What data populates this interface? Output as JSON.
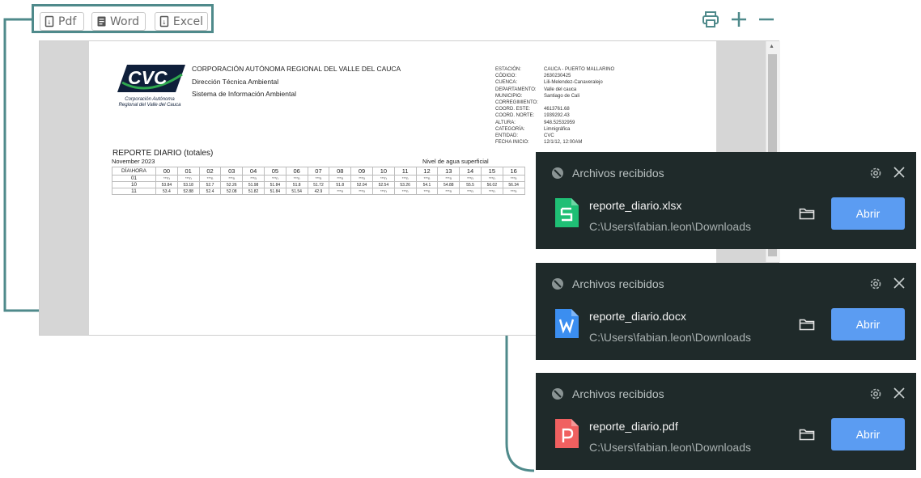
{
  "export_bar": {
    "pdf_label": "Pdf",
    "word_label": "Word",
    "excel_label": "Excel"
  },
  "tools": {
    "print_icon": "printer-icon",
    "zoom_in_icon": "plus-icon",
    "zoom_out_icon": "minus-icon"
  },
  "report": {
    "logo_text": "CVC",
    "logo_sub1": "Corporación Autónoma",
    "logo_sub2": "Regional del Valle del Cauca",
    "org_line1": "CORPORACIÓN AUTÓNOMA  REGIONAL DEL VALLE DEL CAUCA",
    "org_line2": "Dirección Técnica Ambiental",
    "org_line3": "Sistema de Información Ambiental",
    "meta_labels": [
      "ESTACIÓN:",
      "CÓDIGO:",
      "CUENCA:",
      "DEPARTAMENTO:",
      "MUNICIPIO:",
      "CORREGIMIENTO:",
      "COORD. ESTE:",
      "COORD. NORTE:",
      "ALTURA:",
      "CATEGORÍA:",
      "ENTIDAD:",
      "FECHA INICIO:"
    ],
    "meta_values": [
      "CAUCA - PUERTO MALLARINO",
      "2630230425",
      "Lili-Melendez-Canaveralejo",
      "Valle del cauca",
      "Santiago de Cali",
      "",
      "4613761.68",
      "1939292.43",
      "948.52532959",
      "Limnigráfica",
      "CVC",
      "12/1/12, 12:00AM"
    ],
    "title": "REPORTE DIARIO (totales)",
    "month": "November 2023",
    "variable": "Nivel de agua superficial",
    "header_first": "DÍA\\HORA",
    "hours": [
      "00",
      "01",
      "02",
      "03",
      "04",
      "05",
      "06",
      "07",
      "08",
      "09",
      "10",
      "11",
      "12",
      "13",
      "14",
      "15",
      "16"
    ],
    "rows": [
      {
        "day": "01",
        "values": [
          "***n",
          "***n",
          "***n",
          "***n",
          "***n",
          "***n",
          "***n",
          "***n",
          "***n",
          "***n",
          "***n",
          "***n",
          "***n",
          "***n",
          "***n",
          "***n",
          "***n"
        ]
      },
      {
        "day": "10",
        "values": [
          "53.84",
          "53.18",
          "52.7",
          "52.26",
          "51.98",
          "51.84",
          "51.8",
          "51.72",
          "51.8",
          "52.04",
          "52.54",
          "53.26",
          "54.1",
          "54.88",
          "55.5",
          "56.02",
          "56.34"
        ]
      },
      {
        "day": "11",
        "values": [
          "53.4",
          "52.88",
          "52.4",
          "52.08",
          "51.82",
          "51.84",
          "51.54",
          "42.9",
          "***n",
          "***n",
          "***n",
          "***n",
          "***n",
          "***n",
          "***n",
          "***n",
          "***n"
        ]
      }
    ]
  },
  "notifications": [
    {
      "header": "Archivos recibidos",
      "file": "reporte_diario.xlsx",
      "path": "C:\\Users\\fabian.leon\\Downloads",
      "button": "Abrir",
      "icon": "excel-file-icon",
      "color": "#1fbf75"
    },
    {
      "header": "Archivos recibidos",
      "file": "reporte_diario.docx",
      "path": "C:\\Users\\fabian.leon\\Downloads",
      "button": "Abrir",
      "icon": "word-file-icon",
      "color": "#3b8ef0"
    },
    {
      "header": "Archivos recibidos",
      "file": "reporte_diario.pdf",
      "path": "C:\\Users\\fabian.leon\\Downloads",
      "button": "Abrir",
      "icon": "pdf-file-icon",
      "color": "#f06060"
    }
  ],
  "colors": {
    "accent_teal": "#4f8a8b",
    "notification_bg": "#1f2a2a",
    "open_button": "#5b9cf2"
  }
}
